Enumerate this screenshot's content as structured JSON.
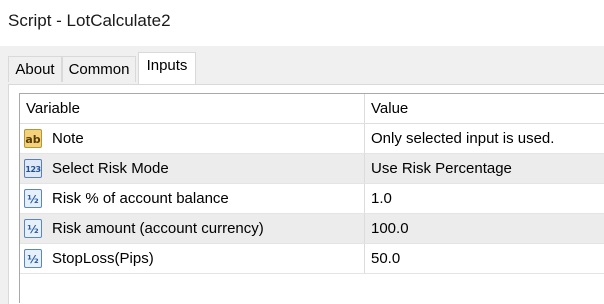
{
  "window": {
    "title": "Script - LotCalculate2"
  },
  "tabs": [
    {
      "label": "About"
    },
    {
      "label": "Common"
    },
    {
      "label": "Inputs"
    }
  ],
  "active_tab": "Inputs",
  "grid": {
    "columns": {
      "variable": "Variable",
      "value": "Value"
    },
    "rows": [
      {
        "icon": "string-icon",
        "icon_text": "ab",
        "variable": "Note",
        "value": "Only selected input is used."
      },
      {
        "icon": "enum-icon",
        "icon_text": "123",
        "variable": "Select Risk Mode",
        "value": "Use Risk Percentage"
      },
      {
        "icon": "double-icon",
        "icon_text": "½",
        "variable": "Risk % of account balance",
        "value": "1.0"
      },
      {
        "icon": "double-icon",
        "icon_text": "½",
        "variable": "Risk amount (account currency)",
        "value": "100.0"
      },
      {
        "icon": "double-icon",
        "icon_text": "½",
        "variable": "StopLoss(Pips)",
        "value": "50.0"
      }
    ]
  },
  "colors": {
    "shaded_row": "#ececec",
    "string_icon": "#f2d27a",
    "numeric_icon": "#dfe8f6"
  }
}
